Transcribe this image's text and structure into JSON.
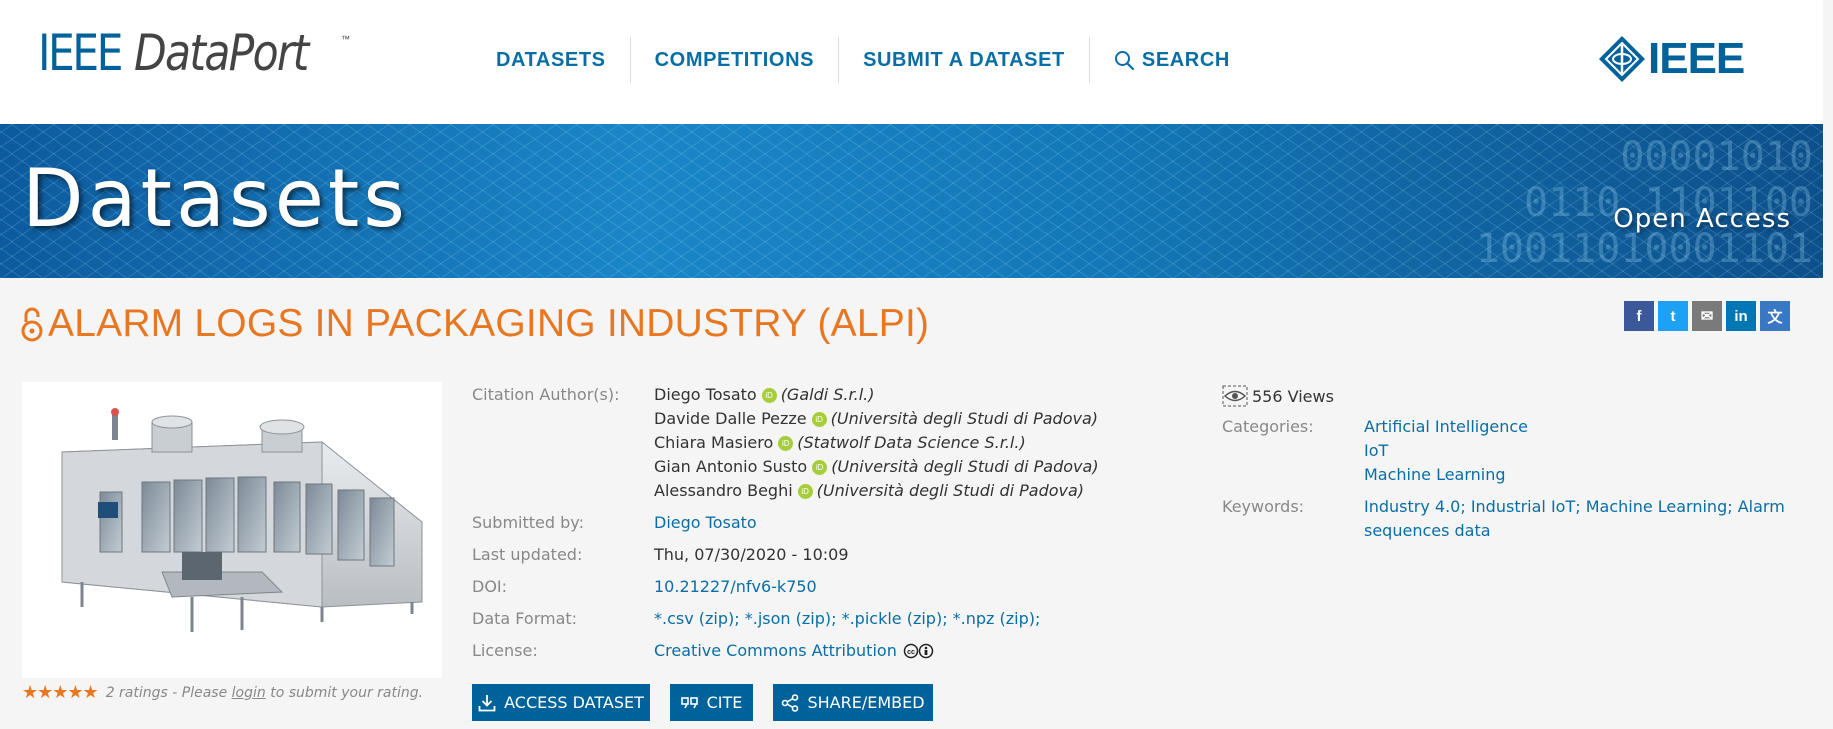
{
  "header": {
    "logo_ieee": "IEEE",
    "logo_dataport": "DataPort",
    "logo_tm": "™",
    "nav": [
      "DATASETS",
      "COMPETITIONS",
      "SUBMIT A DATASET",
      "SEARCH"
    ],
    "brand": "IEEE",
    "brand_color": "#00629b"
  },
  "banner": {
    "title": "Datasets",
    "access": "Open Access",
    "bits": [
      "00001010",
      "0110 1101100",
      "10011010001101"
    ]
  },
  "dataset": {
    "title": "ALARM LOGS IN PACKAGING INDUSTRY (ALPI)",
    "title_color": "#e87722",
    "citation_label": "Citation Author(s):",
    "authors": [
      {
        "name": "Diego Tosato",
        "affiliation": "(Galdi S.r.l.)"
      },
      {
        "name": "Davide Dalle Pezze",
        "affiliation": "(Università degli Studi di Padova)"
      },
      {
        "name": "Chiara Masiero",
        "affiliation": "(Statwolf Data Science S.r.l.)"
      },
      {
        "name": "Gian Antonio Susto",
        "affiliation": "(Università degli Studi di Padova)"
      },
      {
        "name": "Alessandro Beghi",
        "affiliation": "(Università degli Studi di Padova)"
      }
    ],
    "orcid_badge": "iD",
    "submitted_label": "Submitted by:",
    "submitted_by": "Diego Tosato",
    "updated_label": "Last updated:",
    "updated": "Thu, 07/30/2020 - 10:09",
    "doi_label": "DOI:",
    "doi": "10.21227/nfv6-k750",
    "format_label": "Data Format:",
    "format": "*.csv (zip); *.json (zip); *.pickle (zip); *.npz (zip);",
    "license_label": "License:",
    "license": "Creative Commons Attribution",
    "views": "556 Views",
    "categories_label": "Categories:",
    "categories": [
      "Artificial Intelligence",
      "IoT",
      "Machine Learning"
    ],
    "keywords_label": "Keywords:",
    "keywords_line1": "Industry 4.0; Industrial IoT; Machine Learning; Alarm",
    "keywords_line2": "sequences data"
  },
  "rating": {
    "stars": "★★★★★",
    "value_of_5": 5,
    "text_before": "2 ratings - Please ",
    "login": "login",
    "text_after": " to submit your rating."
  },
  "buttons": {
    "access": "ACCESS DATASET",
    "cite": "CITE",
    "share": "SHARE/EMBED"
  },
  "social": [
    {
      "icon": "facebook-icon",
      "glyph": "f",
      "color": "#3b5998"
    },
    {
      "icon": "twitter-icon",
      "glyph": "t",
      "color": "#1da1f2"
    },
    {
      "icon": "email-icon",
      "glyph": "✉",
      "color": "#7a7a7a"
    },
    {
      "icon": "linkedin-icon",
      "glyph": "in",
      "color": "#0077b5"
    },
    {
      "icon": "translate-icon",
      "glyph": "文",
      "color": "#3a78c3"
    }
  ]
}
